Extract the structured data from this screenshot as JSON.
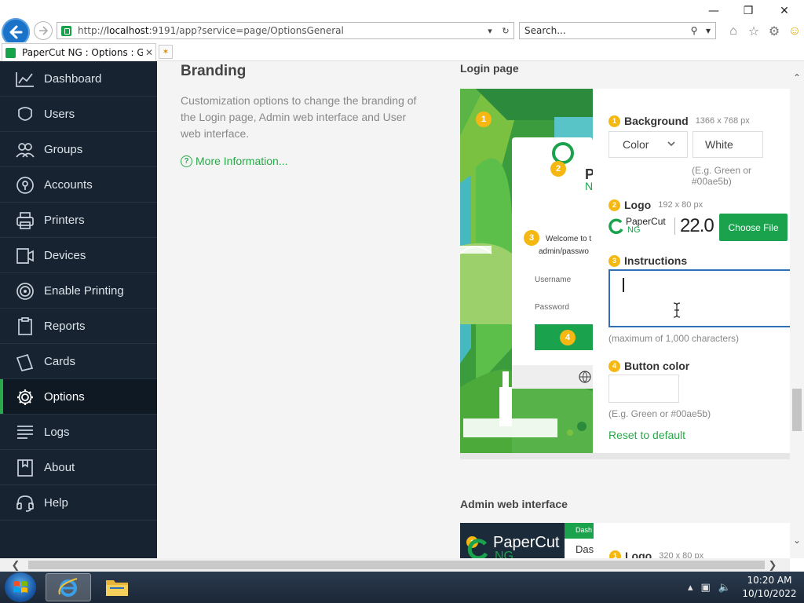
{
  "browser": {
    "address": {
      "url_prefix": "http://",
      "url_host": "localhost",
      "url_rest": ":9191/app?service=page/OptionsGeneral"
    },
    "search_placeholder": "Search...",
    "tab_title": "PaperCut NG : Options : Ge..."
  },
  "sidebar": {
    "items": [
      {
        "label": "Dashboard",
        "icon": "dashboard-icon"
      },
      {
        "label": "Users",
        "icon": "users-icon"
      },
      {
        "label": "Groups",
        "icon": "groups-icon"
      },
      {
        "label": "Accounts",
        "icon": "accounts-icon"
      },
      {
        "label": "Printers",
        "icon": "printer-icon"
      },
      {
        "label": "Devices",
        "icon": "devices-icon"
      },
      {
        "label": "Enable Printing",
        "icon": "enable-printing-icon"
      },
      {
        "label": "Reports",
        "icon": "reports-icon"
      },
      {
        "label": "Cards",
        "icon": "cards-icon"
      },
      {
        "label": "Options",
        "icon": "gear-icon",
        "active": true
      },
      {
        "label": "Logs",
        "icon": "logs-icon"
      },
      {
        "label": "About",
        "icon": "about-icon"
      },
      {
        "label": "Help",
        "icon": "help-icon"
      }
    ],
    "active_color": "#2aa84a"
  },
  "branding": {
    "title": "Branding",
    "description": "Customization options to change the branding of the Login page, Admin web interface and User web interface.",
    "more_info": "More Information..."
  },
  "login_page": {
    "title": "Login page",
    "preview": {
      "welcome_line1": "Welcome to t",
      "welcome_line2": "admin/passwo",
      "username_label": "Username",
      "password_label": "Password",
      "logo_text": "N",
      "logo_text2": "P",
      "badges": [
        "1",
        "2",
        "3",
        "4"
      ]
    },
    "background": {
      "badge": "1",
      "label": "Background",
      "dimensions": "1366 x 768 px",
      "select_value": "Color",
      "value": "White",
      "hint": "(E.g. Green or #00ae5b)"
    },
    "logo": {
      "badge": "2",
      "label": "Logo",
      "dimensions": "192 x 80 px",
      "thumb_brand": "PaperCut",
      "thumb_sub": "NG",
      "thumb_version": "22.0",
      "choose_button": "Choose File"
    },
    "instructions": {
      "badge": "3",
      "label": "Instructions",
      "value": "",
      "hint": "(maximum of 1,000 characters)"
    },
    "button_color": {
      "badge": "4",
      "label": "Button color",
      "value": "",
      "hint": "(E.g. Green or #00ae5b)"
    },
    "reset_link": "Reset to default"
  },
  "admin_interface": {
    "title": "Admin web interface",
    "preview_brand": "PaperCut",
    "preview_sub": "NG",
    "preview_tab": "Dash",
    "preview_sub2": "Das",
    "badge": "1",
    "logo_label": "Logo",
    "logo_dimensions": "320 x 80 px"
  },
  "taskbar": {
    "time": "10:20 AM",
    "date": "10/10/2022"
  },
  "colors": {
    "sidebar_bg": "#172330",
    "accent_green": "#2aa84a",
    "badge_yellow": "#f5b813",
    "focus_blue": "#2f6fb6"
  }
}
